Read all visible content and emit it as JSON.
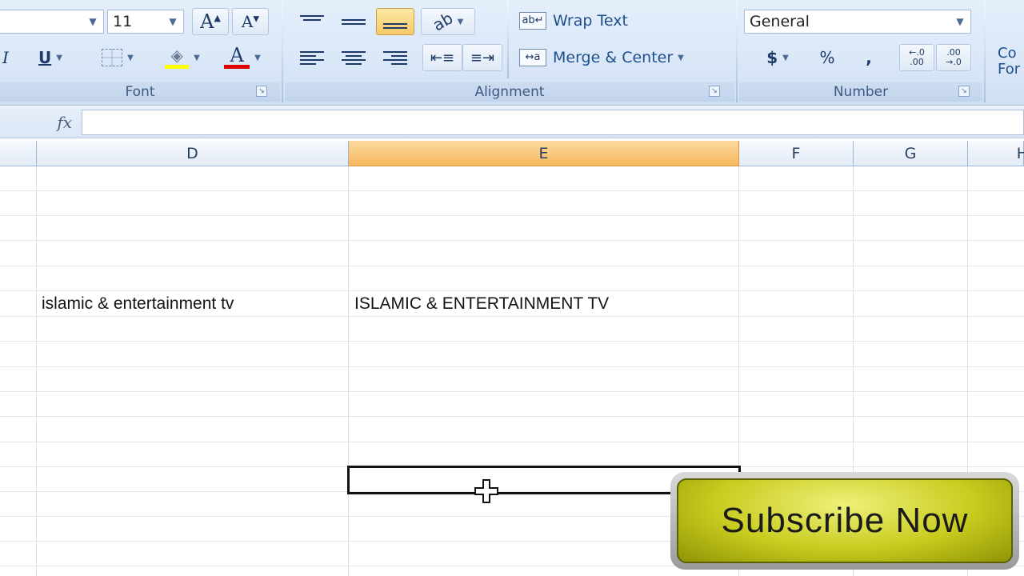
{
  "ribbon": {
    "font": {
      "size_value": "11",
      "group_label": "Font",
      "underline_label": "U"
    },
    "alignment": {
      "wrap_text_label": "Wrap Text",
      "merge_center_label": "Merge & Center",
      "group_label": "Alignment"
    },
    "number": {
      "format_value": "General",
      "currency_label": "$",
      "percent_label": "%",
      "comma_label": ",",
      "group_label": "Number"
    },
    "styles": {
      "conditional_label_line1": "Co",
      "conditional_label_line2": "For"
    }
  },
  "formula_bar": {
    "fx_label": "fx",
    "value": ""
  },
  "columns": [
    {
      "label": ""
    },
    {
      "label": "D"
    },
    {
      "label": "E"
    },
    {
      "label": "F"
    },
    {
      "label": "G"
    },
    {
      "label": "H"
    }
  ],
  "cells": {
    "d_text": "islamic & entertainment tv",
    "e_text": "ISLAMIC & ENTERTAINMENT TV"
  },
  "overlay": {
    "subscribe_label": "Subscribe Now"
  },
  "colors": {
    "selected_column": "#f6b75c",
    "ribbon_bg": "#dbe8f8",
    "subscribe_yellow": "#c8cc1e"
  }
}
